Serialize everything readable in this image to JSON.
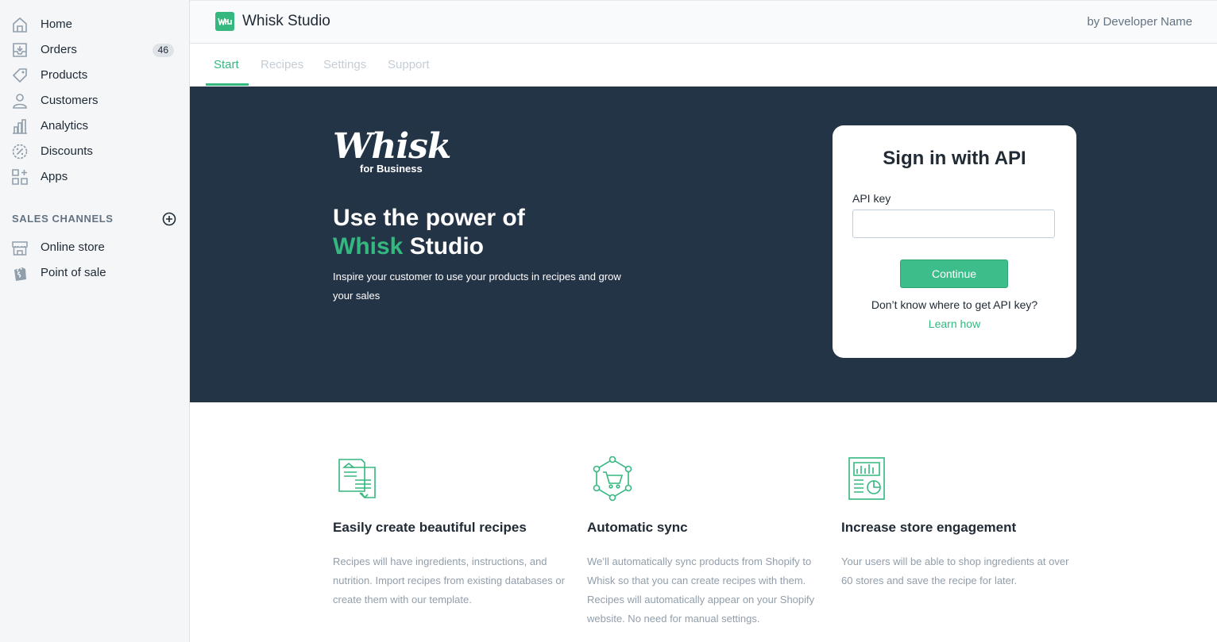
{
  "sidebar": {
    "items": [
      {
        "label": "Home",
        "icon": "home-icon"
      },
      {
        "label": "Orders",
        "icon": "orders-icon",
        "badge": "46"
      },
      {
        "label": "Products",
        "icon": "tag-icon"
      },
      {
        "label": "Customers",
        "icon": "person-icon"
      },
      {
        "label": "Analytics",
        "icon": "bar-chart-icon"
      },
      {
        "label": "Discounts",
        "icon": "discount-icon"
      },
      {
        "label": "Apps",
        "icon": "apps-icon"
      }
    ],
    "sales_channels_heading": "SALES CHANNELS",
    "channels": [
      {
        "label": "Online store",
        "icon": "store-icon"
      },
      {
        "label": "Point of sale",
        "icon": "shopping-bag-icon"
      }
    ]
  },
  "topbar": {
    "app_title": "Whisk Studio",
    "developer": "by Developer Name"
  },
  "tabs": [
    {
      "label": "Start",
      "active": true
    },
    {
      "label": "Recipes",
      "active": false
    },
    {
      "label": "Settings",
      "active": false
    },
    {
      "label": "Support",
      "active": false
    }
  ],
  "hero": {
    "brand_word": "Whisk",
    "brand_sub": "for Business",
    "title_line1": "Use the power of",
    "title_accent": "Whisk",
    "title_rest": " Studio",
    "subtitle": "Inspire your customer to use your products in recipes and grow your sales"
  },
  "signin": {
    "title": "Sign in with API",
    "api_label": "API key",
    "api_value": "",
    "api_placeholder": "",
    "continue_label": "Continue",
    "help_text": "Don’t know where to get API key?",
    "learn_link": "Learn how"
  },
  "features": [
    {
      "icon": "recipe-document-icon",
      "title": "Easily create beautiful recipes",
      "desc": "Recipes will have ingredients, instructions, and nutrition. Import recipes from existing databases or create them with our template."
    },
    {
      "icon": "cart-sync-icon",
      "title": "Automatic sync",
      "desc": "We’ll automatically sync products from Shopify to Whisk so that you can create recipes with them. Recipes will automatically appear on your Shopify website. No need for manual settings."
    },
    {
      "icon": "report-chart-icon",
      "title": "Increase store engagement",
      "desc": "Your users will be able to shop ingredients at over 60 stores and save the recipe for later."
    }
  ],
  "colors": {
    "accent": "#35b87f",
    "hero_bg": "#243447",
    "sidebar_bg": "#f4f6f8"
  }
}
